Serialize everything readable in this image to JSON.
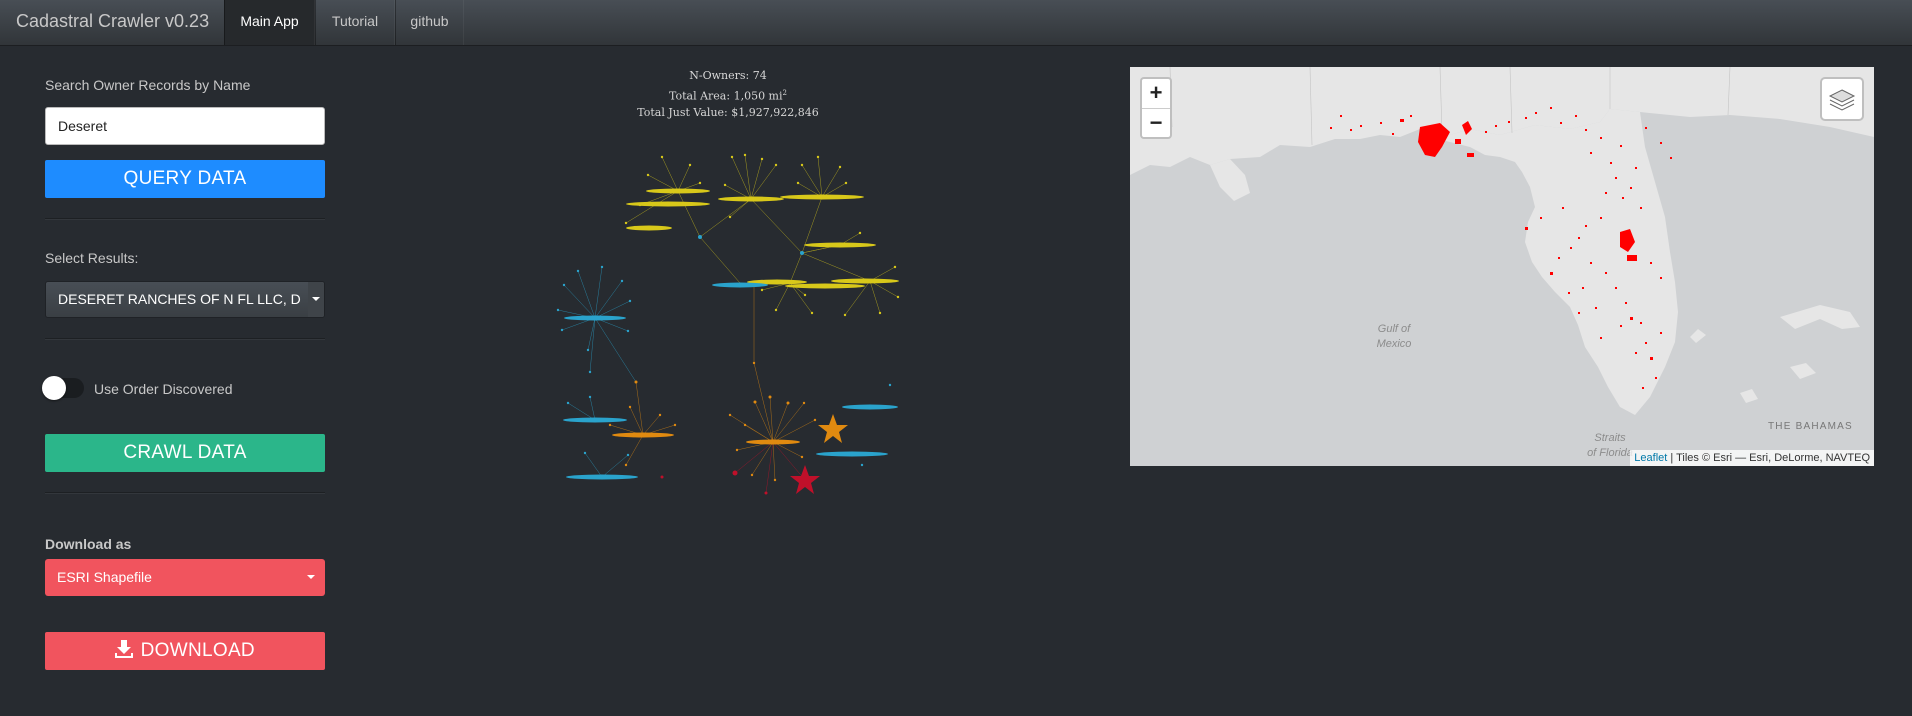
{
  "navbar": {
    "brand": "Cadastral Crawler v0.23",
    "tabs": [
      {
        "label": "Main App",
        "active": true
      },
      {
        "label": "Tutorial",
        "active": false
      },
      {
        "label": "github",
        "active": false
      }
    ]
  },
  "sidebar": {
    "search_label": "Search Owner Records by Name",
    "search_value": "Deseret",
    "query_button": "QUERY DATA",
    "select_results_label": "Select Results:",
    "select_results_value": "DESERET RANCHES OF N FL LLC, D",
    "toggle_label": "Use Order Discovered",
    "toggle_on": false,
    "crawl_button": "CRAWL DATA",
    "download_as_label": "Download as",
    "download_format": "ESRI Shapefile",
    "download_button": "DOWNLOAD"
  },
  "network": {
    "stats": {
      "n_owners": "N-Owners: 74",
      "total_area": "Total Area: 1,050 mi",
      "total_area_sup": "2",
      "total_value": "Total Just Value: $1,927,922,846"
    },
    "colors": {
      "yellow": "#d8c81a",
      "blue": "#2aa3cc",
      "orange": "#e08a10",
      "red": "#c0102a"
    }
  },
  "map": {
    "zoom_in": "+",
    "zoom_out": "−",
    "label_gulf": "Gulf of",
    "label_mexico": "Mexico",
    "label_bahamas": "THE BAHAMAS",
    "label_straits": "Straits",
    "label_florida": "of Florida",
    "attribution_link": "Leaflet",
    "attribution_text": " | Tiles © Esri — Esri, DeLorme, NAVTEQ",
    "parcel_color": "#ff0000"
  }
}
